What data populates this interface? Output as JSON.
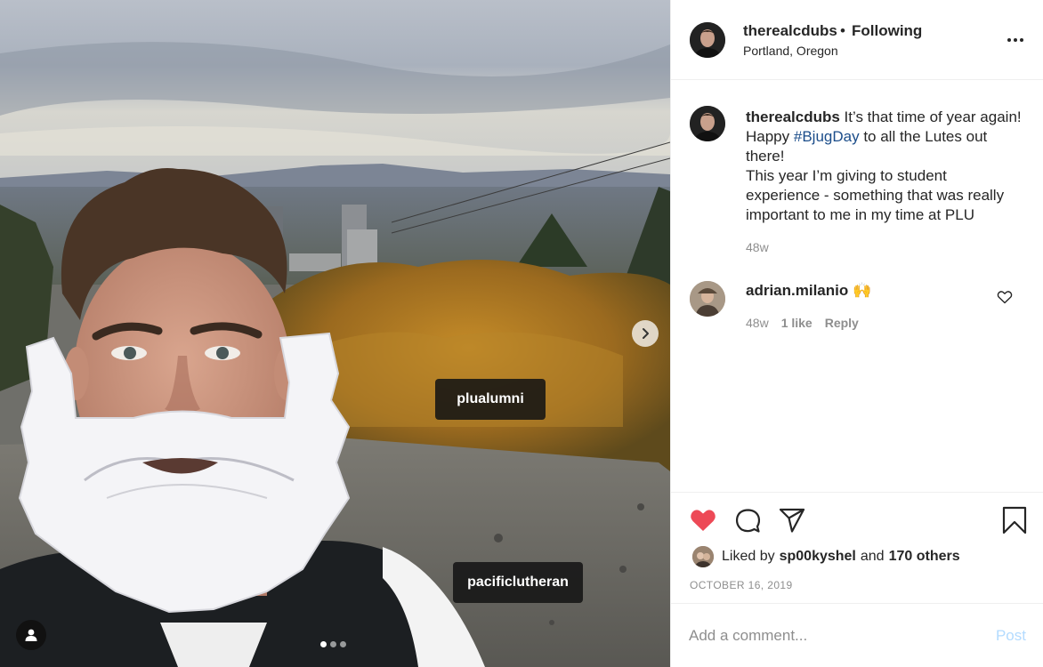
{
  "post": {
    "username": "therealcdubs",
    "separator": "•",
    "follow_status": "Following",
    "location": "Portland, Oregon"
  },
  "photo": {
    "tags": [
      "plualumni",
      "pacificlutheran"
    ],
    "carousel": {
      "count": 3,
      "active": 1
    }
  },
  "caption": {
    "username": "therealcdubs",
    "text_before": "It’s that time of year again! Happy ",
    "hashtag": "#BjugDay",
    "text_after": " to all the Lutes out there!",
    "text_line2": "This year I’m giving to student experience - something that was really important to me in my time at PLU",
    "time": "48w"
  },
  "comment": {
    "username": "adrian.milanio",
    "emoji": "🙌",
    "time": "48w",
    "likes": "1 like",
    "reply": "Reply"
  },
  "likes": {
    "prefix": "Liked by",
    "user": "sp00kyshel",
    "and": "and",
    "others": "170 others"
  },
  "date": "OCTOBER 16, 2019",
  "add_comment": {
    "placeholder": "Add a comment...",
    "post_label": "Post"
  },
  "icons": {
    "like": "heart-filled-icon",
    "comment": "comment-bubble-icon",
    "share": "paper-plane-icon",
    "save": "bookmark-icon",
    "more": "more-dots-icon",
    "next": "chevron-right-icon",
    "user_tags": "person-icon"
  },
  "colors": {
    "like": "#ed4956",
    "hashtag": "#1b4d8a",
    "post_disabled": "#b3dbff",
    "muted": "#8e8e8e"
  }
}
